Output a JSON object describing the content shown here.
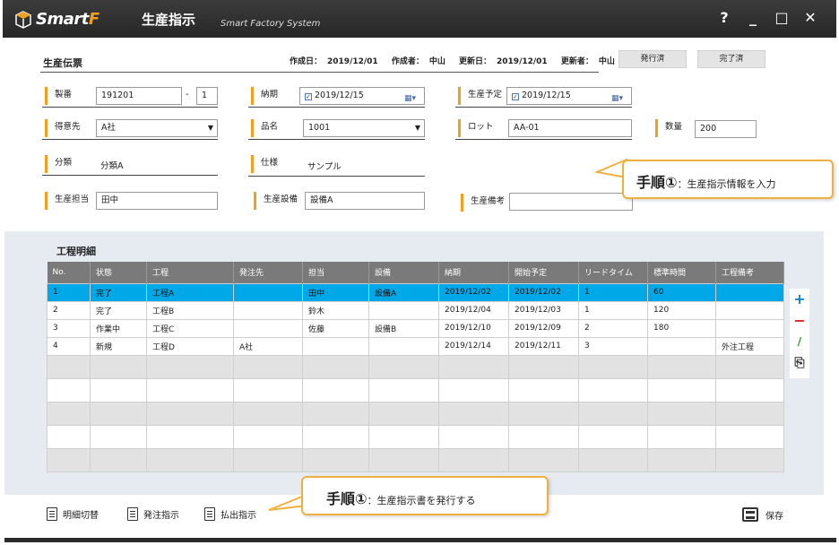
{
  "app": {
    "logo": "Smart",
    "logo_f": "F",
    "title": "生産指示",
    "subtitle": "Smart Factory System"
  },
  "window_buttons": {
    "help": "?",
    "minimize": "_",
    "maximize": "□",
    "close": "✕"
  },
  "header": {
    "title": "生産伝票",
    "created_date_label": "作成日：",
    "created_date": "2019/12/01",
    "creator_label": "作成者：",
    "creator": "中山",
    "updated_date_label": "更新日：",
    "updated_date": "2019/12/01",
    "updater_label": "更新者：",
    "updater": "中山",
    "issued_button": "発行済",
    "completed_button": "完了済"
  },
  "fields": {
    "seiban_label": "製番",
    "seiban_value": "191201",
    "seiban_sep": "-",
    "seiban_sub": "1",
    "deadline_label": "納期",
    "deadline_value": "2019/12/15",
    "plan_label": "生産予定",
    "plan_value": "2019/12/15",
    "customer_label": "得意先",
    "customer_value": "A社",
    "item_label": "品名",
    "item_value": "1001",
    "lot_label": "ロット",
    "lot_value": "AA-01",
    "qty_label": "数量",
    "qty_value": "200",
    "category_label": "分類",
    "category_value": "分類A",
    "spec_label": "仕様",
    "spec_value": "サンプル",
    "staff_label": "生産担当",
    "staff_value": "田中",
    "equipment_label": "生産設備",
    "equipment_value": "設備A",
    "note_label": "生産備考",
    "note_value": ""
  },
  "callouts": {
    "top": {
      "step": "手順①",
      "text": "：生産指示情報を入力"
    },
    "bottom": {
      "step": "手順①",
      "text": "：生産指示書を発行する"
    }
  },
  "detail": {
    "title": "工程明細",
    "columns": [
      "No.",
      "状態",
      "工程",
      "発注先",
      "担当",
      "設備",
      "納期",
      "開始予定",
      "リードタイム",
      "標準時間",
      "工程備考"
    ],
    "rows": [
      [
        "1",
        "完了",
        "工程A",
        "",
        "田中",
        "設備A",
        "2019/12/02",
        "2019/12/02",
        "1",
        "60",
        ""
      ],
      [
        "2",
        "完了",
        "工程B",
        "",
        "鈴木",
        "",
        "2019/12/04",
        "2019/12/03",
        "1",
        "120",
        ""
      ],
      [
        "3",
        "作業中",
        "工程C",
        "",
        "佐藤",
        "設備B",
        "2019/12/10",
        "2019/12/09",
        "2",
        "180",
        ""
      ],
      [
        "4",
        "新規",
        "工程D",
        "A社",
        "",
        "",
        "2019/12/14",
        "2019/12/11",
        "3",
        "",
        "外注工程"
      ]
    ]
  },
  "side_tools": {
    "add": "+",
    "remove": "−",
    "edit": "/",
    "copy": "⎘"
  },
  "footer": {
    "switch_label": "明細切替",
    "order_label": "発注指示",
    "issue_label": "払出指示",
    "save_label": "保存"
  }
}
